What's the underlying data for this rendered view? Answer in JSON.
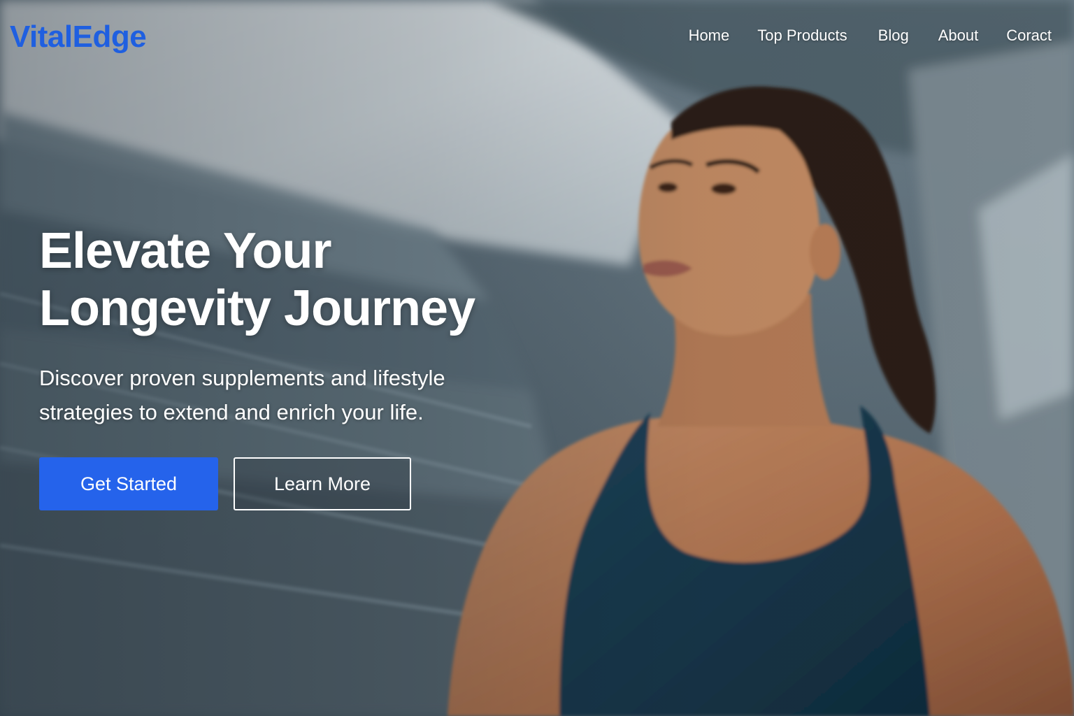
{
  "brand": {
    "name": "VitalEdge",
    "color": "#1f5fe0"
  },
  "nav": {
    "items": [
      {
        "label": "Home"
      },
      {
        "label": "Top Products"
      },
      {
        "label": "Blog"
      },
      {
        "label": "About"
      },
      {
        "label": "Coract"
      }
    ]
  },
  "hero": {
    "title_line_1": "Elevate Your",
    "title_line_2": "Longevity Journey",
    "subtitle": "Discover proven supplements and lifestyle strategies to extend and enrich your life.",
    "primary_button": "Get Started",
    "secondary_button": "Learn More",
    "primary_color": "#2563eb",
    "image_subject": "woman-athlete-photo"
  }
}
